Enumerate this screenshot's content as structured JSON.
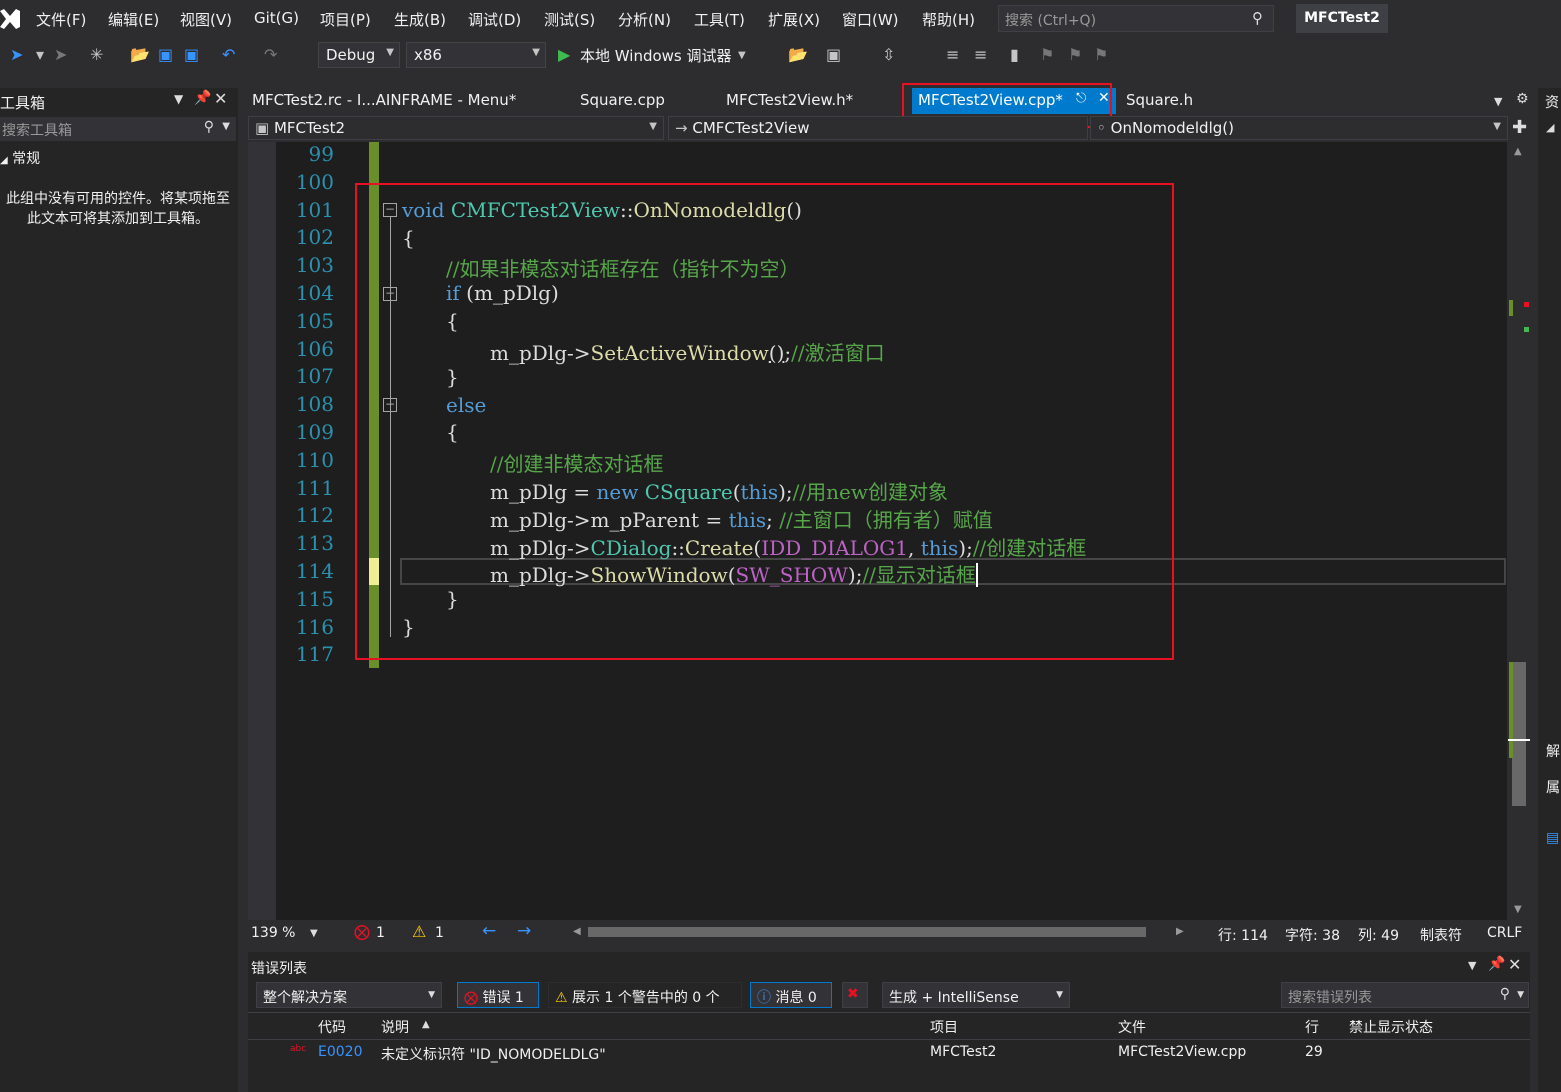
{
  "menu": {
    "items": [
      "文件(F)",
      "编辑(E)",
      "视图(V)",
      "Git(G)",
      "项目(P)",
      "生成(B)",
      "调试(D)",
      "测试(S)",
      "分析(N)",
      "工具(T)",
      "扩展(X)",
      "窗口(W)",
      "帮助(H)"
    ],
    "search_placeholder": "搜索 (Ctrl+Q)",
    "project_title": "MFCTest2"
  },
  "toolbar": {
    "config": "Debug",
    "platform": "x86",
    "run_label": "本地 Windows 调试器"
  },
  "toolbox": {
    "title": "工具箱",
    "search_placeholder": "搜索工具箱",
    "group": "常规",
    "empty_text": "此组中没有可用的控件。将某项拖至此文本可将其添加到工具箱。"
  },
  "tabs": [
    "MFCTest2.rc - I...AINFRAME - Menu*",
    "Square.cpp",
    "MFCTest2View.h*",
    "MFCTest2View.cpp*",
    "Square.h"
  ],
  "nav": {
    "project": "MFCTest2",
    "class": "CMFCTest2View",
    "member": "OnNomodeldlg()"
  },
  "editor": {
    "line_numbers": [
      "99",
      "100",
      "101",
      "102",
      "103",
      "104",
      "105",
      "106",
      "107",
      "108",
      "109",
      "110",
      "111",
      "112",
      "113",
      "114",
      "115",
      "116",
      "117"
    ],
    "code": {
      "l101_kw": "void",
      "l101_cls": "CMFCTest2View",
      "l101_sep": "::",
      "l101_fn": "OnNomodeldlg",
      "l101_paren": "()",
      "l102": "{",
      "l103": "//如果非模态对话框存在（指针不为空）",
      "l104_kw": "if",
      "l104_rest": "(m_pDlg)",
      "l105": "{",
      "l106_var": "m_pDlg",
      "l106_arrow": "->",
      "l106_fn": "SetActiveWindow",
      "l106_paren": "()",
      "l106_semi": ";",
      "l106_cm": "//激活窗口",
      "l107": "}",
      "l108": "else",
      "l109": "{",
      "l110": "//创建非模态对话框",
      "l111_var": "m_pDlg = ",
      "l111_new": "new",
      "l111_cls": "CSquare",
      "l111_p1": "(",
      "l111_this": "this",
      "l111_p2": ");",
      "l111_cm": "//用new创建对象",
      "l112_var": "m_pDlg->m_pParent = ",
      "l112_this": "this",
      "l112_semi": ";",
      "l112_cm": "//主窗口（拥有者）赋值",
      "l113_var": "m_pDlg->",
      "l113_cls": "CDialog",
      "l113_sep": "::",
      "l113_fn": "Create",
      "l113_p1": "(",
      "l113_mac": "IDD_DIALOG1",
      "l113_comma": ", ",
      "l113_this": "this",
      "l113_p2": ");",
      "l113_cm": "//创建对话框",
      "l114_var": "m_pDlg->",
      "l114_fn": "ShowWindow",
      "l114_p1": "(",
      "l114_mac": "SW_SHOW",
      "l114_p2": ");",
      "l114_cm": "//显示对话框",
      "l115": "}",
      "l116": "}"
    }
  },
  "status": {
    "zoom": "139 %",
    "errors": "1",
    "warnings": "1",
    "line": "行: 114",
    "char": "字符: 38",
    "col": "列: 49",
    "tabs": "制表符",
    "eol": "CRLF"
  },
  "errorlist": {
    "title": "错误列表",
    "scope": "整个解决方案",
    "errors_btn": "错误 1",
    "warnings_btn": "展示 1 个警告中的 0 个",
    "messages_btn": "消息 0",
    "build_filter": "生成 + IntelliSense",
    "search_placeholder": "搜索错误列表",
    "columns": [
      "代码",
      "说明",
      "项目",
      "文件",
      "行",
      "禁止显示状态"
    ],
    "rows": [
      {
        "code": "E0020",
        "desc": "未定义标识符 \"ID_NOMODELDLG\"",
        "project": "MFCTest2",
        "file": "MFCTest2View.cpp",
        "line": "29"
      }
    ]
  },
  "right_strip": [
    "资",
    "解",
    "属"
  ],
  "colors": {
    "accent": "#007acc",
    "highlight": "#e81123",
    "comment": "#57a64a",
    "keyword": "#569cd6",
    "type": "#4ec9b0",
    "function": "#dcdcaa",
    "macro": "#bd63c5"
  }
}
